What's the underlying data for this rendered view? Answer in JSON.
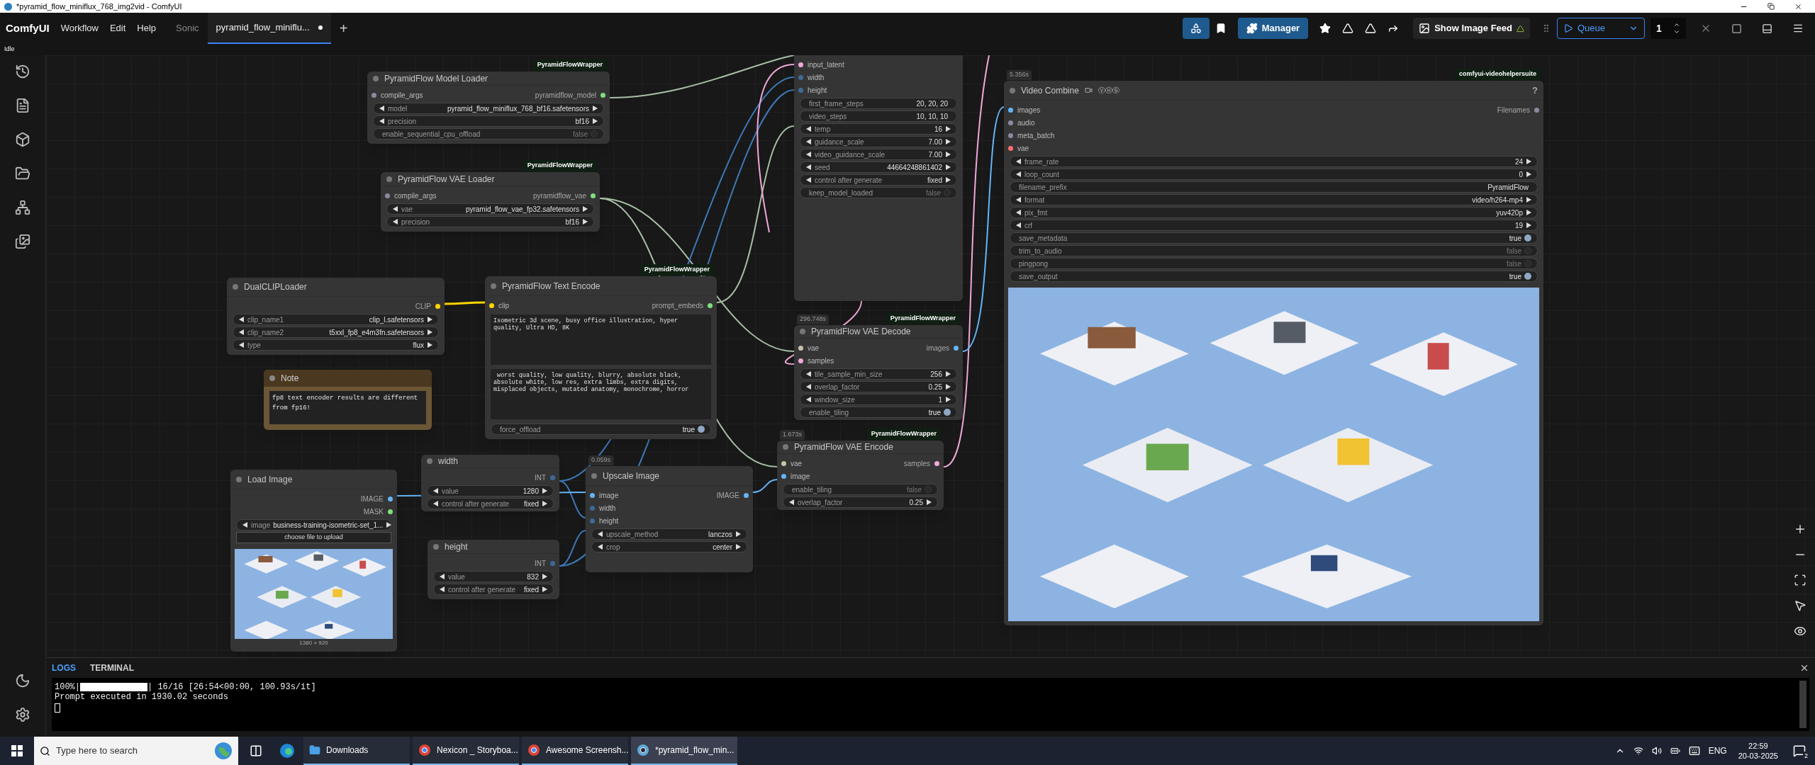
{
  "window": {
    "title": "*pyramid_flow_miniflux_768_img2vid - ComfyUI"
  },
  "menu_bar": {
    "app_name": "ComfyUI",
    "menus": [
      "Workflow",
      "Edit",
      "Help"
    ],
    "workflow_tabs": [
      {
        "label": "Sonic",
        "selected": false,
        "unsaved": false
      },
      {
        "label": "pyramid_flow_miniflu...",
        "selected": true,
        "unsaved": true
      }
    ],
    "new_tab": "+",
    "manager": "Manager",
    "image_feed": "Show Image Feed",
    "queue": "Queue",
    "batch_count": "1"
  },
  "status": "Idle",
  "nodes": [
    {
      "kind": "node",
      "title": "PyramidFlow Model Loader",
      "badge": "PyramidFlowWrapper",
      "inputs": [
        {
          "name": "compile_args",
          "color": "#8a8aa0"
        }
      ],
      "outputs": [
        {
          "name": "pyramidflow_model",
          "color": "#7ee07e"
        }
      ],
      "widgets": [
        {
          "kind": "combo",
          "label": "model",
          "value": "pyramid_flow_miniflux_768_bf16.safetensors"
        },
        {
          "kind": "combo",
          "label": "precision",
          "value": "bf16"
        },
        {
          "kind": "toggle",
          "label": "enable_sequential_cpu_offload",
          "value": "false",
          "on": false
        }
      ]
    },
    {
      "kind": "node",
      "title": "PyramidFlow VAE Loader",
      "badge": "PyramidFlowWrapper",
      "inputs": [
        {
          "name": "compile_args",
          "color": "#8a8aa0"
        }
      ],
      "outputs": [
        {
          "name": "pyramidflow_vae",
          "color": "#7ee07e"
        }
      ],
      "widgets": [
        {
          "kind": "combo",
          "label": "vae",
          "value": "pyramid_flow_vae_fp32.safetensors"
        },
        {
          "kind": "combo",
          "label": "precision",
          "value": "bf16"
        }
      ]
    },
    {
      "kind": "node",
      "inputs": [
        {
          "name": "input_latent",
          "color": "#f0a8d8"
        },
        {
          "name": "width",
          "color": "#3d6a98"
        },
        {
          "name": "height",
          "color": "#3d6a98"
        }
      ],
      "widgets": [
        {
          "kind": "text",
          "label": "first_frame_steps",
          "value": "20, 20, 20"
        },
        {
          "kind": "text",
          "label": "video_steps",
          "value": "10, 10, 10"
        },
        {
          "kind": "combo",
          "label": "temp",
          "value": "16"
        },
        {
          "kind": "combo",
          "label": "guidance_scale",
          "value": "7.00"
        },
        {
          "kind": "combo",
          "label": "video_guidance_scale",
          "value": "7.00"
        },
        {
          "kind": "combo",
          "label": "seed",
          "value": "44664248861402"
        },
        {
          "kind": "combo",
          "label": "control after generate",
          "value": "fixed"
        },
        {
          "kind": "toggle",
          "label": "keep_model_loaded",
          "value": "false",
          "on": false
        }
      ]
    },
    {
      "kind": "node",
      "title": "Video Combine",
      "title_badge": "ⓋⒽⓈ",
      "help": "?",
      "timing": "5.356s",
      "badge": "comfyui-videohelpersuite",
      "inputs": [
        {
          "name": "images",
          "color": "#64b5f6"
        },
        {
          "name": "audio",
          "color": "#8a8aa0"
        },
        {
          "name": "meta_batch",
          "color": "#8a8aa0"
        },
        {
          "name": "vae",
          "color": "#ff6e6e"
        }
      ],
      "outputs": [
        {
          "name": "Filenames",
          "color": "#8a8aa0"
        }
      ],
      "widgets": [
        {
          "kind": "combo",
          "label": "frame_rate",
          "value": "24"
        },
        {
          "kind": "combo",
          "label": "loop_count",
          "value": "0"
        },
        {
          "kind": "text",
          "label": "filename_prefix",
          "value": "PyramidFlow"
        },
        {
          "kind": "combo",
          "label": "format",
          "value": "video/h264-mp4"
        },
        {
          "kind": "combo",
          "label": "pix_fmt",
          "value": "yuv420p"
        },
        {
          "kind": "combo",
          "label": "crf",
          "value": "19"
        },
        {
          "kind": "toggle",
          "label": "save_metadata",
          "value": "true",
          "on": true
        },
        {
          "kind": "toggle",
          "label": "trim_to_audio",
          "value": "false",
          "on": false
        },
        {
          "kind": "toggle",
          "label": "pingpong",
          "value": "false",
          "on": false
        },
        {
          "kind": "toggle",
          "label": "save_output",
          "value": "true",
          "on": true
        }
      ],
      "preview": {
        "kind": "picture"
      }
    },
    {
      "kind": "node",
      "title": "DualCLIPLoader",
      "outputs": [
        {
          "name": "CLIP",
          "color": "#ffd500"
        }
      ],
      "widgets": [
        {
          "kind": "combo",
          "label": "clip_name1",
          "value": "clip_l.safetensors"
        },
        {
          "kind": "combo",
          "label": "clip_name2",
          "value": "t5xxl_fp8_e4m3fn.safetensors"
        },
        {
          "kind": "combo",
          "label": "type",
          "value": "flux"
        }
      ]
    },
    {
      "kind": "note",
      "title": "Note",
      "text": "fp8 text encoder results are different from fp16!"
    },
    {
      "kind": "node",
      "title": "PyramidFlow Text Encode",
      "badge": "PyramidFlowWrapper",
      "inputs": [
        {
          "name": "clip",
          "color": "#ffd500"
        }
      ],
      "outputs": [
        {
          "name": "prompt_embeds",
          "color": "#7ee07e"
        }
      ],
      "prompts": [
        "Isometric 3d scene, busy office illustration, hyper quality, Ultra HD, 8K",
        " worst quality, low quality, blurry, absolute black, absolute white, low res, extra limbs, extra digits, misplaced objects, mutated anatomy, monochrome, horror"
      ],
      "widgets": [
        {
          "kind": "toggle",
          "label": "force_offload",
          "value": "true",
          "on": true
        }
      ]
    },
    {
      "kind": "node",
      "title": "PyramidFlow VAE Decode",
      "timing": "296.748s",
      "badge": "PyramidFlowWrapper",
      "inputs": [
        {
          "name": "vae",
          "color": "#c8c2a8"
        },
        {
          "name": "samples",
          "color": "#f0a8d8"
        }
      ],
      "outputs": [
        {
          "name": "images",
          "color": "#64b5f6"
        }
      ],
      "widgets": [
        {
          "kind": "combo",
          "label": "tile_sample_min_size",
          "value": "256"
        },
        {
          "kind": "combo",
          "label": "overlap_factor",
          "value": "0.25"
        },
        {
          "kind": "combo",
          "label": "window_size",
          "value": "1"
        },
        {
          "kind": "toggle",
          "label": "enable_tiling",
          "value": "true",
          "on": true
        }
      ]
    },
    {
      "kind": "node",
      "title": "Load Image",
      "outputs": [
        {
          "name": "IMAGE",
          "color": "#64b5f6"
        },
        {
          "name": "MASK",
          "color": "#7ee07e"
        }
      ],
      "widgets": [
        {
          "kind": "combo",
          "label": "image",
          "value": "business-training-isometric-set_1..."
        }
      ],
      "upload_button": "choose file to upload",
      "preview": {
        "kind": "picture"
      },
      "caption": "1380 × 920"
    },
    {
      "kind": "node",
      "title": "width",
      "outputs": [
        {
          "name": "INT",
          "color": "#3d6a98"
        }
      ],
      "widgets": [
        {
          "kind": "combo",
          "label": "value",
          "value": "1280"
        },
        {
          "kind": "combo",
          "label": "control after generate",
          "value": "fixed"
        }
      ]
    },
    {
      "kind": "node",
      "title": "height",
      "outputs": [
        {
          "name": "INT",
          "color": "#3d6a98"
        }
      ],
      "widgets": [
        {
          "kind": "combo",
          "label": "value",
          "value": "832"
        },
        {
          "kind": "combo",
          "label": "control after generate",
          "value": "fixed"
        }
      ]
    },
    {
      "kind": "node",
      "title": "Upscale Image",
      "timing": "0.059s",
      "inputs": [
        {
          "name": "image",
          "color": "#64b5f6"
        },
        {
          "name": "width",
          "color": "#3d6a98"
        },
        {
          "name": "height",
          "color": "#3d6a98"
        }
      ],
      "outputs": [
        {
          "name": "IMAGE",
          "color": "#64b5f6"
        }
      ],
      "widgets": [
        {
          "kind": "combo",
          "label": "upscale_method",
          "value": "lanczos"
        },
        {
          "kind": "combo",
          "label": "crop",
          "value": "center"
        }
      ]
    },
    {
      "kind": "node",
      "title": "PyramidFlow VAE Encode",
      "timing": "1.673s",
      "badge": "PyramidFlowWrapper",
      "inputs": [
        {
          "name": "vae",
          "color": "#c8c2a8"
        },
        {
          "name": "image",
          "color": "#64b5f6"
        }
      ],
      "outputs": [
        {
          "name": "samples",
          "color": "#f0a8d8"
        }
      ],
      "widgets": [
        {
          "kind": "toggle",
          "label": "enable_tiling",
          "value": "false",
          "on": false
        },
        {
          "kind": "combo",
          "label": "overlap_factor",
          "value": "0.25"
        }
      ]
    }
  ],
  "logs": {
    "tabs": [
      {
        "label": "LOGS",
        "selected": true
      },
      {
        "label": "TERMINAL",
        "selected": false
      }
    ],
    "lines": [
      {
        "kind": "progress",
        "prefix": "100%|",
        "level": 1,
        "suffix": "| 16/16 [26:54<00:00, 100.93s/it]"
      },
      {
        "kind": "text",
        "text": "Prompt executed in 1930.02 seconds"
      }
    ]
  },
  "taskbar": {
    "search": {
      "placeholder": "Type here to search"
    },
    "apps": [
      {
        "label": "Downloads",
        "selected": false
      },
      {
        "label": "Nexicon _ Storyboa...",
        "selected": false
      },
      {
        "label": "Awesome Screensh...",
        "selected": false
      },
      {
        "label": "*pyramid_flow_min...",
        "selected": true
      }
    ],
    "language": "ENG",
    "time": "22:59",
    "date": "20-03-2025",
    "notifications": "2"
  }
}
